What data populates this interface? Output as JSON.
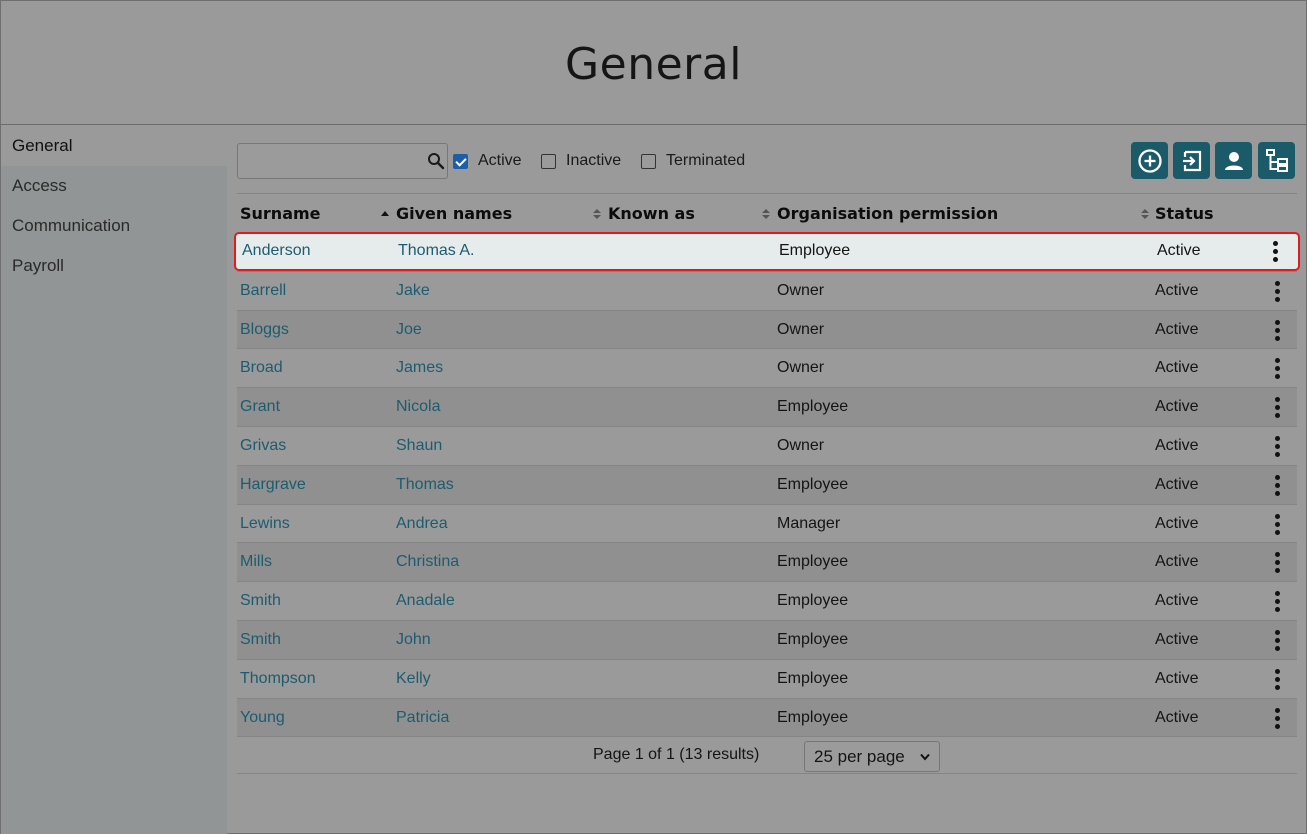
{
  "page": {
    "title": "General"
  },
  "sidebar": {
    "items": [
      {
        "label": "General"
      },
      {
        "label": "Access"
      },
      {
        "label": "Communication"
      },
      {
        "label": "Payroll"
      }
    ]
  },
  "filters": {
    "search_value": "",
    "active": {
      "label": "Active",
      "checked": true
    },
    "inactive": {
      "label": "Inactive",
      "checked": false
    },
    "terminated": {
      "label": "Terminated",
      "checked": false
    }
  },
  "toolbar": {
    "icons": [
      "add-circle-icon",
      "login-icon",
      "person-icon",
      "hierarchy-icon"
    ]
  },
  "table": {
    "columns": [
      "Surname",
      "Given names",
      "Known as",
      "Organisation permission",
      "Status"
    ],
    "sorted_column": "Surname",
    "sort_direction": "ascending",
    "rows": [
      {
        "surname": "Anderson",
        "given": "Thomas A.",
        "known": "",
        "permission": "Employee",
        "status": "Active"
      },
      {
        "surname": "Barrell",
        "given": "Jake",
        "known": "",
        "permission": "Owner",
        "status": "Active"
      },
      {
        "surname": "Bloggs",
        "given": "Joe",
        "known": "",
        "permission": "Owner",
        "status": "Active"
      },
      {
        "surname": "Broad",
        "given": "James",
        "known": "",
        "permission": "Owner",
        "status": "Active"
      },
      {
        "surname": "Grant",
        "given": "Nicola",
        "known": "",
        "permission": "Employee",
        "status": "Active"
      },
      {
        "surname": "Grivas",
        "given": "Shaun",
        "known": "",
        "permission": "Owner",
        "status": "Active"
      },
      {
        "surname": "Hargrave",
        "given": "Thomas",
        "known": "",
        "permission": "Employee",
        "status": "Active"
      },
      {
        "surname": "Lewins",
        "given": "Andrea",
        "known": "",
        "permission": "Manager",
        "status": "Active"
      },
      {
        "surname": "Mills",
        "given": "Christina",
        "known": "",
        "permission": "Employee",
        "status": "Active"
      },
      {
        "surname": "Smith",
        "given": "Anadale",
        "known": "",
        "permission": "Employee",
        "status": "Active"
      },
      {
        "surname": "Smith",
        "given": "John",
        "known": "",
        "permission": "Employee",
        "status": "Active"
      },
      {
        "surname": "Thompson",
        "given": "Kelly",
        "known": "",
        "permission": "Employee",
        "status": "Active"
      },
      {
        "surname": "Young",
        "given": "Patricia",
        "known": "",
        "permission": "Employee",
        "status": "Active"
      }
    ]
  },
  "pagination": {
    "info": "Page 1 of 1 (13 results)",
    "per_page": "25 per page"
  },
  "colors": {
    "accent": "#1b5a68",
    "link": "#1d5c6e",
    "highlight_border": "#e11b1b"
  }
}
